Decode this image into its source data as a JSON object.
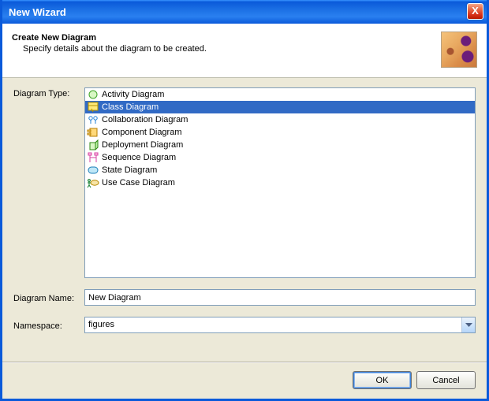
{
  "window": {
    "title": "New Wizard",
    "close": "X"
  },
  "banner": {
    "title": "Create New Diagram",
    "subtitle": "Specify details about the diagram to be created."
  },
  "labels": {
    "diagramType": "Diagram Type:",
    "diagramName": "Diagram Name:",
    "namespace": "Namespace:"
  },
  "diagramTypes": {
    "items": [
      {
        "label": "Activity Diagram",
        "icon": "activity",
        "selected": false
      },
      {
        "label": "Class Diagram",
        "icon": "class",
        "selected": true
      },
      {
        "label": "Collaboration Diagram",
        "icon": "collaboration",
        "selected": false
      },
      {
        "label": "Component Diagram",
        "icon": "component",
        "selected": false
      },
      {
        "label": "Deployment Diagram",
        "icon": "deployment",
        "selected": false
      },
      {
        "label": "Sequence Diagram",
        "icon": "sequence",
        "selected": false
      },
      {
        "label": "State Diagram",
        "icon": "state",
        "selected": false
      },
      {
        "label": "Use Case Diagram",
        "icon": "usecase",
        "selected": false
      }
    ]
  },
  "diagramName": {
    "value": "New Diagram"
  },
  "namespace": {
    "value": "figures"
  },
  "buttons": {
    "ok": "OK",
    "cancel": "Cancel"
  }
}
